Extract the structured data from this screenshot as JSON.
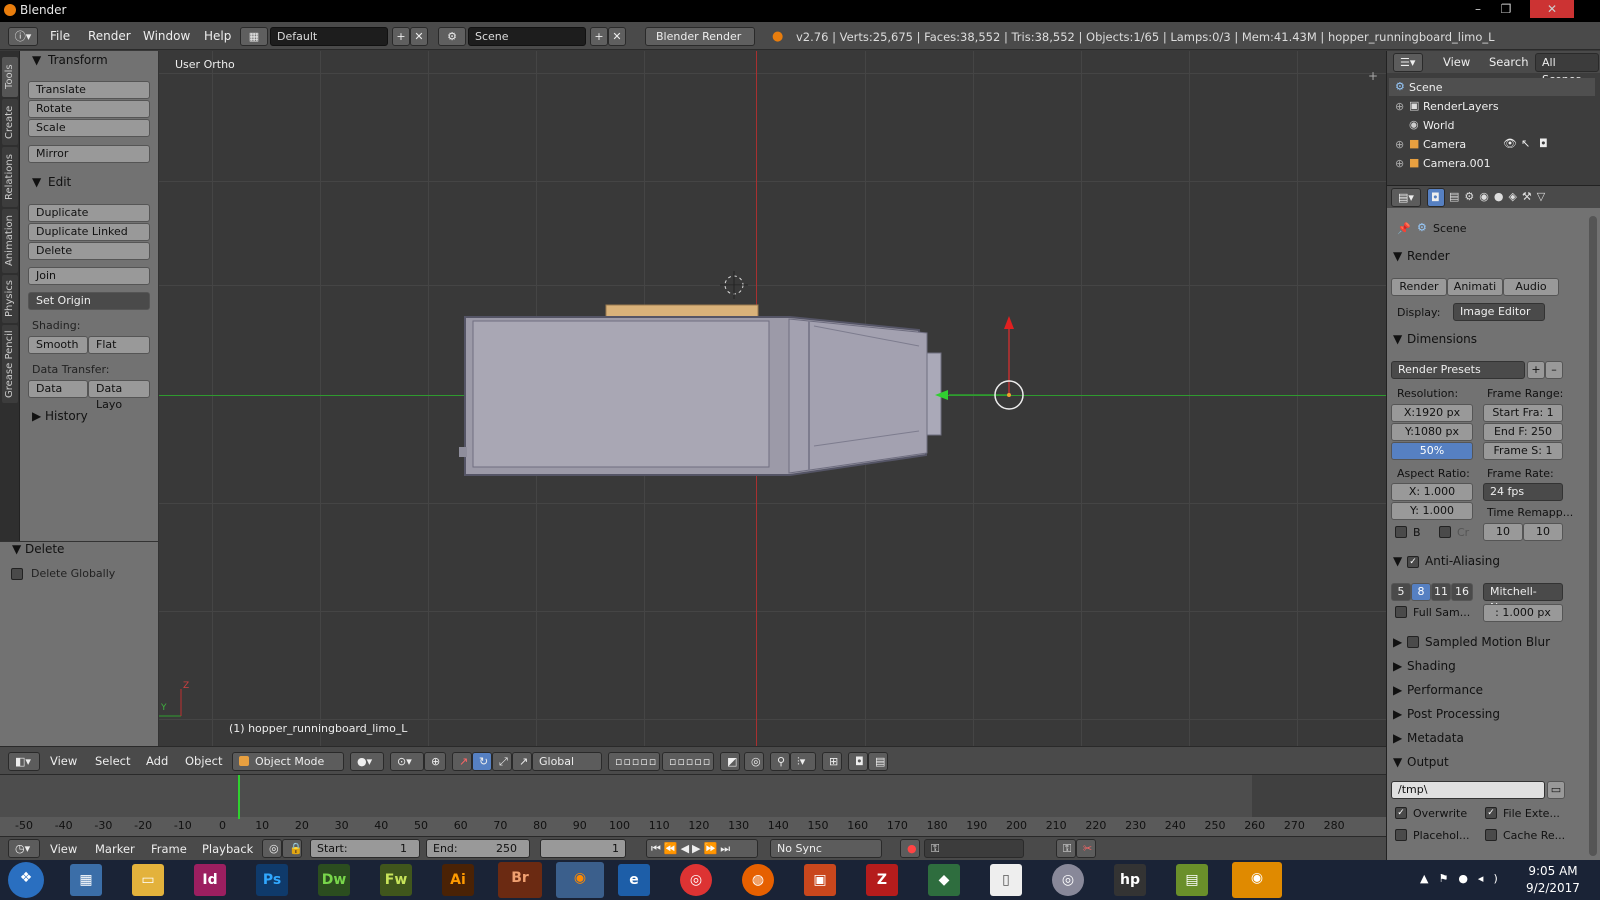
{
  "window": {
    "title": "Blender",
    "controls": [
      "–",
      "❐",
      "✕"
    ]
  },
  "topbar": {
    "menus": [
      "File",
      "Render",
      "Window",
      "Help"
    ],
    "screen_layout": "Default",
    "scene": "Scene",
    "engine": "Blender Render",
    "stats": "v2.76 | Verts:25,675 | Faces:38,552 | Tris:38,552 | Objects:1/65 | Lamps:0/3 | Mem:41.43M | hopper_runningboard_limo_L"
  },
  "left_tabs": [
    "Tools",
    "Create",
    "Relations",
    "Animation",
    "Physics",
    "Grease Pencil"
  ],
  "toolshelf": {
    "transform_title": "Transform",
    "translate": "Translate",
    "rotate": "Rotate",
    "scale": "Scale",
    "mirror": "Mirror",
    "edit_title": "Edit",
    "duplicate": "Duplicate",
    "duplicate_linked": "Duplicate Linked",
    "delete": "Delete",
    "join": "Join",
    "set_origin": "Set Origin",
    "shading_label": "Shading:",
    "smooth": "Smooth",
    "flat": "Flat",
    "data_transfer_label": "Data Transfer:",
    "data": "Data",
    "data_layout": "Data Layo",
    "history_title": "History"
  },
  "redo_panel": {
    "title": "Delete",
    "delete_globally": "Delete Globally"
  },
  "viewport": {
    "view_label": "User Ortho",
    "object_label": "(1) hopper_runningboard_limo_L",
    "axis_y": "Y",
    "axis_z": "Z"
  },
  "viewport_header": {
    "menus": [
      "View",
      "Select",
      "Add",
      "Object"
    ],
    "mode": "Object Mode",
    "orientation": "Global"
  },
  "outliner": {
    "menus": [
      "View",
      "Search"
    ],
    "filter": "All Scenes",
    "items": [
      "Scene",
      "RenderLayers",
      "World",
      "Camera",
      "Camera.001"
    ]
  },
  "properties": {
    "context": "Scene",
    "render_title": "Render",
    "render_btn": "Render",
    "animation_btn": "Animati",
    "audio_btn": "Audio",
    "display_label": "Display:",
    "display_value": "Image Editor",
    "dimensions_title": "Dimensions",
    "render_presets": "Render Presets",
    "resolution_label": "Resolution:",
    "res_x": "X:1920 px",
    "res_y": "Y:1080 px",
    "res_pct": "50%",
    "frame_range_label": "Frame Range:",
    "start_frame": "Start Fra: 1",
    "end_frame": "End F: 250",
    "frame_step": "Frame S: 1",
    "aspect_label": "Aspect Ratio:",
    "aspect_x": "X:",
    "aspect_x_val": "1.000",
    "aspect_y": "Y:",
    "aspect_y_val": "1.000",
    "frame_rate_label": "Frame Rate:",
    "fps": "24 fps",
    "time_remap_label": "Time Remapp...",
    "remap_old": "10",
    "remap_new": "10",
    "border_b": "B",
    "border_cr": "Cr",
    "aa_title": "Anti-Aliasing",
    "aa_samples": [
      "5",
      "8",
      "11",
      "16"
    ],
    "aa_filter": "Mitchell-Ne...",
    "full_sample": "Full Sam...",
    "filter_size": ": 1.000 px",
    "sections": [
      "Sampled Motion Blur",
      "Shading",
      "Performance",
      "Post Processing",
      "Metadata"
    ],
    "output_title": "Output",
    "output_path": "/tmp\\",
    "overwrite": "Overwrite",
    "file_extensions": "File Exte...",
    "placeholders": "Placehol...",
    "cache_result": "Cache Re..."
  },
  "timeline": {
    "ticks": [
      "-50",
      "-40",
      "-30",
      "-20",
      "-10",
      "0",
      "10",
      "20",
      "30",
      "40",
      "50",
      "60",
      "70",
      "80",
      "90",
      "100",
      "110",
      "120",
      "130",
      "140",
      "150",
      "160",
      "170",
      "180",
      "190",
      "200",
      "210",
      "220",
      "230",
      "240",
      "250",
      "260",
      "270",
      "280"
    ],
    "current_frame_value": 0
  },
  "timeline_header": {
    "menus": [
      "View",
      "Marker",
      "Frame",
      "Playback"
    ],
    "start": "Start:",
    "start_val": "1",
    "end": "End:",
    "end_val": "250",
    "current": "1",
    "sync": "No Sync"
  },
  "taskbar": {
    "apps": [
      "Id",
      "Ps",
      "Dw",
      "Fw",
      "Ai",
      "Br"
    ],
    "time": "9:05 AM",
    "date": "9/2/2017"
  },
  "colors": {
    "accent": "#5680c2",
    "panel": "#727272",
    "viewport": "#393939",
    "x_axis": "#c03030",
    "y_axis": "#2f9a2f"
  }
}
